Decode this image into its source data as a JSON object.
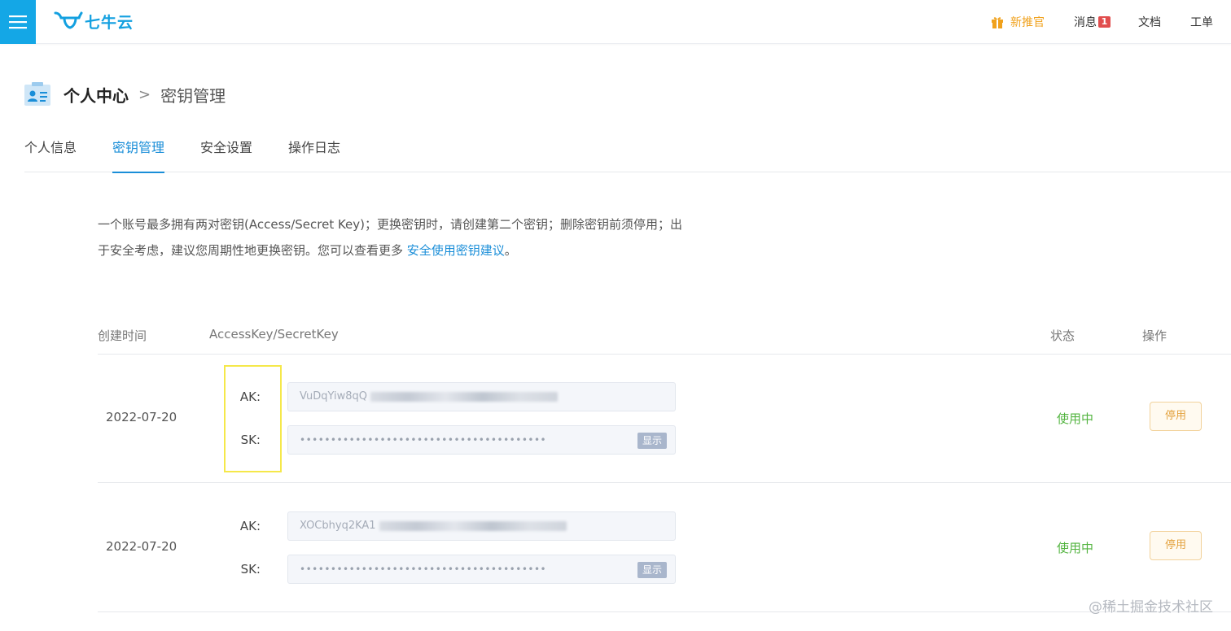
{
  "topbar": {
    "brand": "七牛云",
    "promo_label": "新推官",
    "messages_label": "消息",
    "messages_count": "1",
    "docs_label": "文档",
    "ticket_label": "工单"
  },
  "breadcrumb": {
    "root": "个人中心",
    "separator": ">",
    "current": "密钥管理"
  },
  "tabs": [
    {
      "label": "个人信息",
      "active": false
    },
    {
      "label": "密钥管理",
      "active": true
    },
    {
      "label": "安全设置",
      "active": false
    },
    {
      "label": "操作日志",
      "active": false
    }
  ],
  "notice": {
    "text": "一个账号最多拥有两对密钥(Access/Secret Key)；更换密钥时，请创建第二个密钥；删除密钥前须停用；出于安全考虑，建议您周期性地更换密钥。您可以查看更多 ",
    "link_text": "安全使用密钥建议",
    "suffix": "。"
  },
  "table": {
    "headers": {
      "created": "创建时间",
      "keys": "AccessKey/SecretKey",
      "status": "状态",
      "action": "操作"
    },
    "rows": [
      {
        "date": "2022-07-20",
        "ak_label": "AK:",
        "ak_prefix": "VuDqYiw8qQ",
        "sk_label": "SK:",
        "sk_masked": "••••••••••••••••••••••••••••••••••••••••",
        "show_label": "显示",
        "status": "使用中",
        "action_label": "停用"
      },
      {
        "date": "2022-07-20",
        "ak_label": "AK:",
        "ak_prefix": "XOCbhyq2KA1",
        "sk_label": "SK:",
        "sk_masked": "••••••••••••••••••••••••••••••••••••••••",
        "show_label": "显示",
        "status": "使用中",
        "action_label": "停用"
      }
    ]
  },
  "watermark": "@稀土掘金技术社区",
  "colors": {
    "brand": "#14a7e6",
    "link": "#1a8ed8",
    "status_ok": "#53b440",
    "warning": "#e3a13d",
    "badge": "#e14d4d",
    "highlight": "#f5e84a"
  },
  "icons": {
    "menu": "hamburger-icon",
    "logo": "qiniu-logo-icon",
    "promo": "gift-icon",
    "page": "id-card-icon"
  }
}
